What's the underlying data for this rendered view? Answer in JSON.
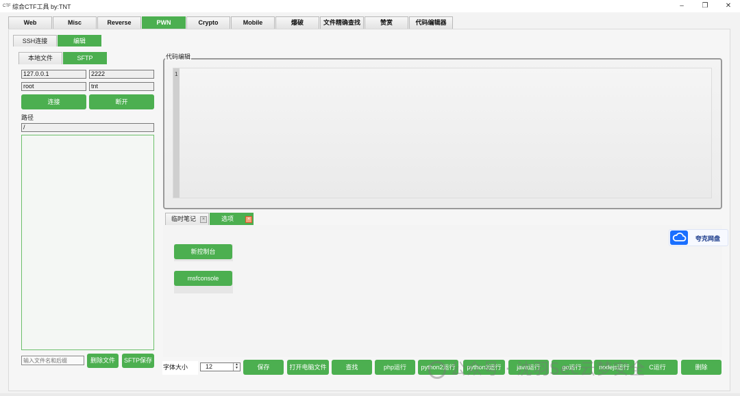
{
  "window": {
    "title": "综合CTF工具   by:TNT",
    "icon_text": "CTF"
  },
  "main_tabs": [
    {
      "label": "Web"
    },
    {
      "label": "Misc"
    },
    {
      "label": "Reverse"
    },
    {
      "label": "PWN"
    },
    {
      "label": "Crypto"
    },
    {
      "label": "Mobile"
    },
    {
      "label": "爆破"
    },
    {
      "label": "文件精确查找"
    },
    {
      "label": "赞赏"
    },
    {
      "label": "代码编辑器"
    }
  ],
  "sub_tabs": [
    {
      "label": "SSH连接"
    },
    {
      "label": "编辑"
    }
  ],
  "left_panel": {
    "tabs": [
      {
        "label": "本地文件"
      },
      {
        "label": "SFTP"
      }
    ],
    "host": "127.0.0.1",
    "port": "2222",
    "username": "root",
    "password": "tnt",
    "connect_label": "连接",
    "disconnect_label": "断开",
    "path_label": "路径",
    "path_value": "/",
    "filename_placeholder": "输入文件名和后缀",
    "delete_label": "删除文件",
    "sftp_save_label": "SFTP保存"
  },
  "editor": {
    "group_label": "代码编辑",
    "line_numbers": [
      "1"
    ]
  },
  "bottom_tabs": [
    {
      "label": "临时笔记"
    },
    {
      "label": "选项"
    }
  ],
  "options": {
    "new_console_label": "新控制台",
    "msfconsole_label": "msfconsole"
  },
  "toolbar": {
    "font_size_label": "字体大小",
    "font_size_value": "12",
    "buttons": [
      {
        "label": "保存"
      },
      {
        "label": "打开电脑文件"
      },
      {
        "label": "查找"
      },
      {
        "label": "php运行"
      },
      {
        "label": "python2运行"
      },
      {
        "label": "python3运行"
      },
      {
        "label": "java运行"
      },
      {
        "label": "go运行"
      },
      {
        "label": "nodejs运行"
      },
      {
        "label": "C运行"
      },
      {
        "label": "删除"
      }
    ]
  },
  "overlays": {
    "quark_label": "夸克网盘",
    "watermark_text": "公众号 · 沈羽Sec云梦安全"
  },
  "colors": {
    "accent": "#4caf50",
    "quark_blue": "#1a6fff"
  },
  "icons": {
    "minimize": "minimize-icon",
    "restore": "restore-icon",
    "close": "close-icon",
    "cloud": "cloud-icon"
  }
}
